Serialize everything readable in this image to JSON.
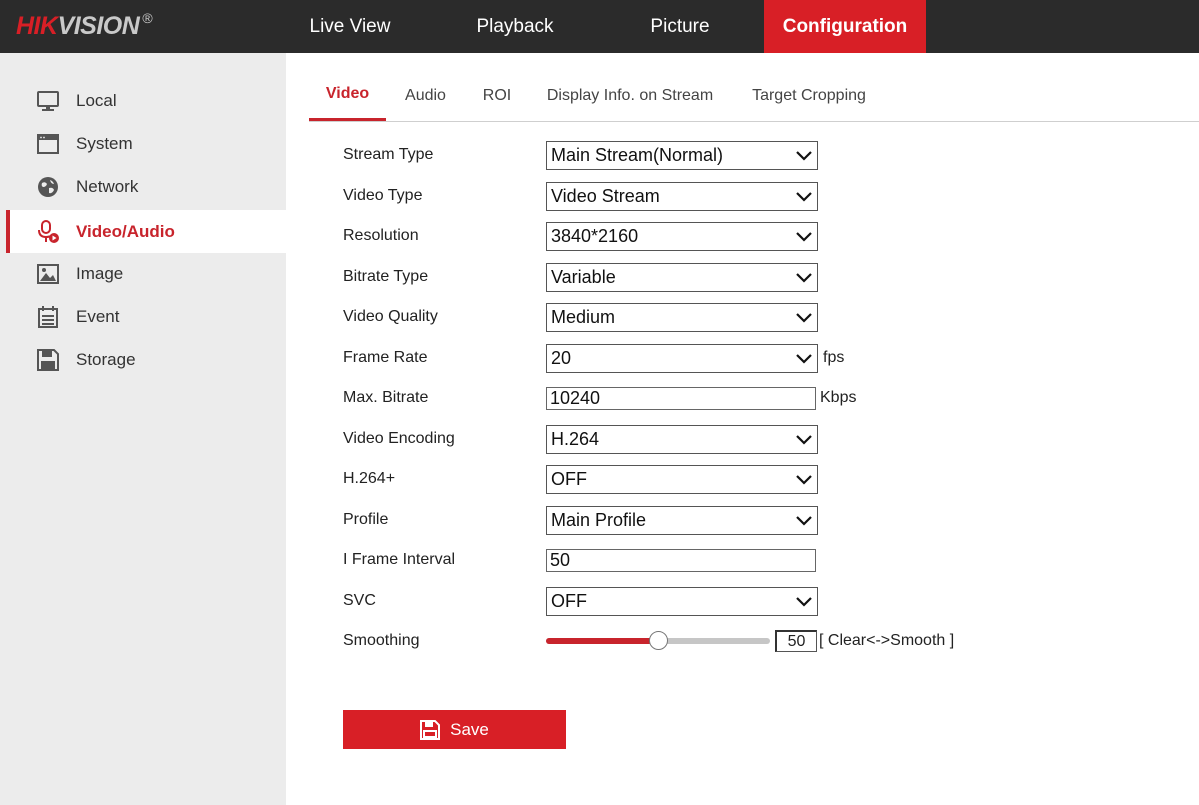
{
  "brand": {
    "logo_red": "HIK",
    "logo_grey": "VISION",
    "logo_mark": "®"
  },
  "topnav": {
    "items": [
      {
        "label": "Live View"
      },
      {
        "label": "Playback"
      },
      {
        "label": "Picture"
      },
      {
        "label": "Configuration"
      }
    ],
    "active": "Configuration"
  },
  "sidebar": {
    "items": [
      {
        "label": "Local",
        "icon": "monitor-icon"
      },
      {
        "label": "System",
        "icon": "system-window-icon"
      },
      {
        "label": "Network",
        "icon": "globe-icon"
      },
      {
        "label": "Video/Audio",
        "icon": "microphone-video-icon"
      },
      {
        "label": "Image",
        "icon": "image-icon"
      },
      {
        "label": "Event",
        "icon": "calendar-list-icon"
      },
      {
        "label": "Storage",
        "icon": "floppy-disk-icon"
      }
    ],
    "active": "Video/Audio"
  },
  "tabs": {
    "items": [
      {
        "label": "Video"
      },
      {
        "label": "Audio"
      },
      {
        "label": "ROI"
      },
      {
        "label": "Display Info. on Stream"
      },
      {
        "label": "Target Cropping"
      }
    ],
    "active": "Video"
  },
  "form": {
    "stream_type": {
      "label": "Stream Type",
      "value": "Main Stream(Normal)"
    },
    "video_type": {
      "label": "Video Type",
      "value": "Video Stream"
    },
    "resolution": {
      "label": "Resolution",
      "value": "3840*2160"
    },
    "bitrate_type": {
      "label": "Bitrate Type",
      "value": "Variable"
    },
    "video_quality": {
      "label": "Video Quality",
      "value": "Medium"
    },
    "frame_rate": {
      "label": "Frame Rate",
      "value": "20",
      "unit": "fps"
    },
    "max_bitrate": {
      "label": "Max. Bitrate",
      "value": "10240",
      "unit": "Kbps"
    },
    "video_encoding": {
      "label": "Video Encoding",
      "value": "H.264"
    },
    "h264_plus": {
      "label": "H.264+",
      "value": "OFF"
    },
    "profile": {
      "label": "Profile",
      "value": "Main Profile"
    },
    "i_frame_interval": {
      "label": "I Frame Interval",
      "value": "50"
    },
    "svc": {
      "label": "SVC",
      "value": "OFF"
    },
    "smoothing": {
      "label": "Smoothing",
      "value": "50",
      "level": 0.5,
      "hint": "[ Clear<->Smooth ]"
    }
  },
  "save": {
    "label": "Save"
  },
  "colors": {
    "accent": "#d81f26",
    "topbar": "#2b2b2b",
    "sidebar": "#ececec"
  }
}
